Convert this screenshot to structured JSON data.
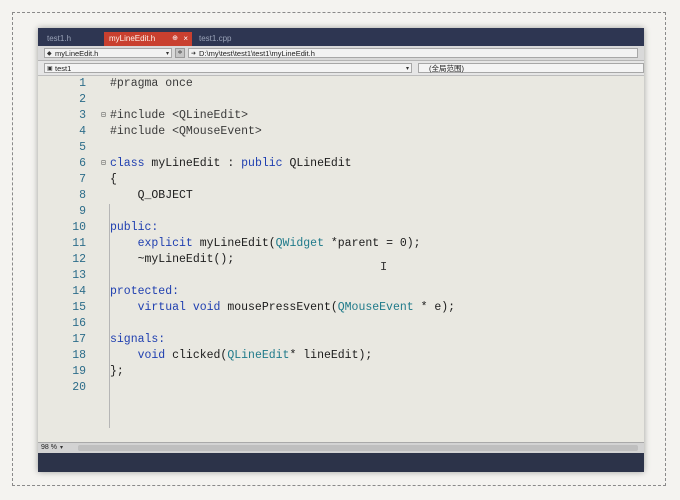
{
  "tabs": [
    {
      "label": "test1.h"
    },
    {
      "label": "myLineEdit.h",
      "pin": "⊕",
      "close": "×"
    },
    {
      "label": "test1.cpp"
    }
  ],
  "nav": {
    "file_select": "myLineEdit.h",
    "path": "D:\\my\\test\\test1\\test1\\myLineEdit.h"
  },
  "scope": {
    "project": "test1",
    "scope_label": "(全局范围)"
  },
  "editor": {
    "lines": [
      {
        "n": "1"
      },
      {
        "n": "2"
      },
      {
        "n": "3"
      },
      {
        "n": "4"
      },
      {
        "n": "5"
      },
      {
        "n": "6"
      },
      {
        "n": "7"
      },
      {
        "n": "8"
      },
      {
        "n": "9"
      },
      {
        "n": "10"
      },
      {
        "n": "11"
      },
      {
        "n": "12"
      },
      {
        "n": "13"
      },
      {
        "n": "14"
      },
      {
        "n": "15"
      },
      {
        "n": "16"
      },
      {
        "n": "17"
      },
      {
        "n": "18"
      },
      {
        "n": "19"
      },
      {
        "n": "20"
      }
    ],
    "code": {
      "l1": "#pragma once",
      "l3": "#include <QLineEdit>",
      "l4": "#include <QMouseEvent>",
      "l6_class": "class",
      "l6_name": " myLineEdit : ",
      "l6_public": "public",
      "l6_base": " QLineEdit",
      "l7": "{",
      "l8": "    Q_OBJECT",
      "l10": "public:",
      "l11_kw": "    explicit",
      "l11_fn": " myLineEdit(",
      "l11_ty": "QWidget",
      "l11_rest": " *parent = 0);",
      "l12": "    ~myLineEdit();",
      "l14": "protected:",
      "l15_kw": "    virtual void",
      "l15_fn": " mousePressEvent(",
      "l15_ty": "QMouseEvent",
      "l15_rest": " * e);",
      "l17": "signals:",
      "l18_kw": "    void",
      "l18_fn": " clicked(",
      "l18_ty": "QLineEdit",
      "l18_rest": "* lineEdit);",
      "l19": "};"
    }
  },
  "status": {
    "zoom": "98 %"
  },
  "icons": {
    "fold_open": "⊟",
    "dropdown": "▾",
    "ibeam": "I"
  }
}
